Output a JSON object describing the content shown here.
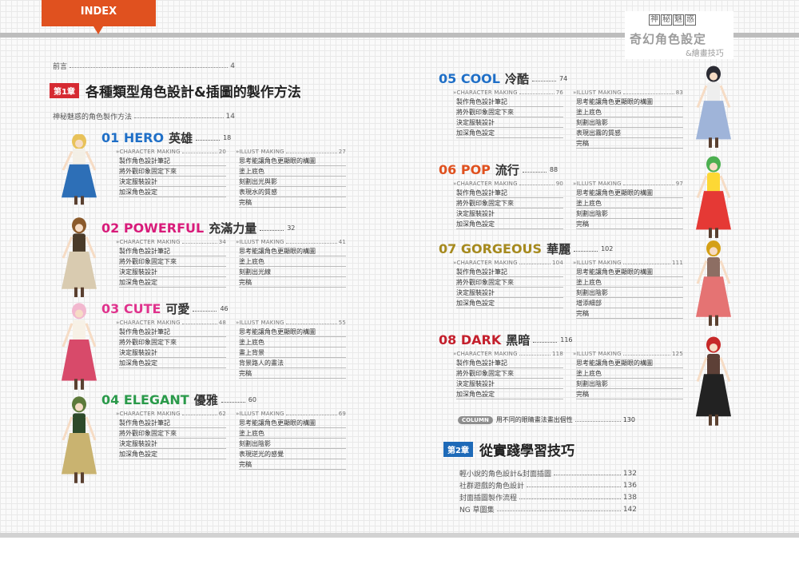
{
  "header": {
    "tab_label": "INDEX",
    "brand_seal": [
      "神",
      "秘",
      "魅",
      "惑"
    ],
    "brand_title": "奇幻角色設定",
    "brand_subtitle": "&繪畫技巧"
  },
  "preface": {
    "label": "前言",
    "page": "4"
  },
  "chapter1": {
    "badge": "第1章",
    "title": "各種類型角色設計&插圖的製作方法"
  },
  "intro": {
    "label": "神秘魅惑的角色製作方法",
    "page": "14"
  },
  "char_making_label": "CHARACTER MAKING",
  "illust_making_label": "ILLUST MAKING",
  "sections": [
    {
      "num": "01 HERO",
      "zh": "英雄",
      "page": "18",
      "color": "#1f6fc7",
      "char_page": "20",
      "illust_page": "27",
      "char_steps": [
        "製作角色設計筆記",
        "將外觀印象固定下來",
        "決定服裝設計",
        "加深角色設定"
      ],
      "illust_steps": [
        "思考能讓角色更顯眼的構圖",
        "塗上底色",
        "刻劃出光與影",
        "表現水的質感",
        "完稿"
      ]
    },
    {
      "num": "02 POWERFUL",
      "zh": "充滿力量",
      "page": "32",
      "color": "#d81b7a",
      "char_page": "34",
      "illust_page": "41",
      "char_steps": [
        "製作角色設計筆記",
        "將外觀印象固定下來",
        "決定服裝設計",
        "加深角色設定"
      ],
      "illust_steps": [
        "思考能讓角色更顯眼的構圖",
        "塗上底色",
        "刻劃出光線",
        "完稿"
      ]
    },
    {
      "num": "03 CUTE",
      "zh": "可愛",
      "page": "46",
      "color": "#e0338d",
      "char_page": "48",
      "illust_page": "55",
      "char_steps": [
        "製作角色設計筆記",
        "將外觀印象固定下來",
        "決定服裝設計",
        "加深角色設定"
      ],
      "illust_steps": [
        "思考能讓角色更顯眼的構圖",
        "塗上底色",
        "畫上背景",
        "背景路人的畫法",
        "完稿"
      ]
    },
    {
      "num": "04 ELEGANT",
      "zh": "優雅",
      "page": "60",
      "color": "#2a9a4a",
      "char_page": "62",
      "illust_page": "69",
      "char_steps": [
        "製作角色設計筆記",
        "將外觀印象固定下來",
        "決定服裝設計",
        "加深角色設定"
      ],
      "illust_steps": [
        "思考能讓角色更顯眼的構圖",
        "塗上底色",
        "刻劃出陰影",
        "表現逆光的感覺",
        "完稿"
      ]
    },
    {
      "num": "05 COOL",
      "zh": "冷酷",
      "page": "74",
      "color": "#1f6fc7",
      "char_page": "76",
      "illust_page": "83",
      "char_steps": [
        "製作角色設計筆記",
        "將外觀印象固定下來",
        "決定服裝設計",
        "加深角色設定"
      ],
      "illust_steps": [
        "思考能讓角色更顯眼的構圖",
        "塗上底色",
        "刻劃出陰影",
        "表現出霧的質感",
        "完稿"
      ]
    },
    {
      "num": "06 POP",
      "zh": "流行",
      "page": "88",
      "color": "#e0511f",
      "char_page": "90",
      "illust_page": "97",
      "char_steps": [
        "製作角色設計筆記",
        "將外觀印象固定下來",
        "決定服裝設計",
        "加深角色設定"
      ],
      "illust_steps": [
        "思考能讓角色更顯眼的構圖",
        "塗上底色",
        "刻劃出陰影",
        "完稿"
      ]
    },
    {
      "num": "07 GORGEOUS",
      "zh": "華麗",
      "page": "102",
      "color": "#a68a1e",
      "char_page": "104",
      "illust_page": "111",
      "char_steps": [
        "製作角色設計筆記",
        "將外觀印象固定下來",
        "決定服裝設計",
        "加深角色設定"
      ],
      "illust_steps": [
        "思考能讓角色更顯眼的構圖",
        "塗上底色",
        "刻劃出陰影",
        "增添細部",
        "完稿"
      ]
    },
    {
      "num": "08 DARK",
      "zh": "黑暗",
      "page": "116",
      "color": "#c41f2c",
      "char_page": "118",
      "illust_page": "125",
      "char_steps": [
        "製作角色設計筆記",
        "將外觀印象固定下來",
        "決定服裝設計",
        "加深角色設定"
      ],
      "illust_steps": [
        "思考能讓角色更顯眼的構圖",
        "塗上底色",
        "刻劃出陰影",
        "完稿"
      ]
    }
  ],
  "column": {
    "badge": "COLUMN",
    "label": "用不同的眼睛畫法畫出個性",
    "page": "130"
  },
  "chapter2": {
    "badge": "第2章",
    "title": "從實踐學習技巧"
  },
  "chapter2_items": [
    {
      "label": "輕小說的角色設計&封面插圖",
      "page": "132"
    },
    {
      "label": "社群遊戲的角色設計",
      "page": "136"
    },
    {
      "label": "封面插圖製作流程",
      "page": "138"
    },
    {
      "label": "NG 草圖集",
      "page": "142"
    }
  ]
}
